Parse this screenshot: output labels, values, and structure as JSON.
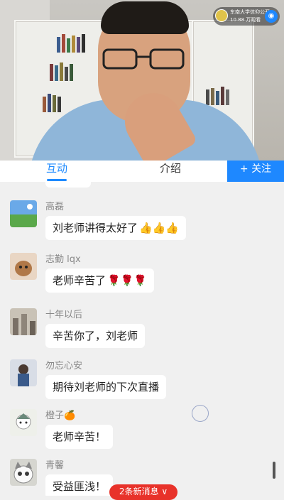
{
  "live": {
    "channel_name": "东南大学信仰公开",
    "views": "10.88 万观看"
  },
  "tabs": {
    "interact": "互动",
    "intro": "介绍",
    "follow": "+ 关注"
  },
  "messages": [
    {
      "user": "高磊",
      "text": "刘老师讲得太好了",
      "emoji": "👍👍👍"
    },
    {
      "user": "志勤 lqx",
      "text": "老师辛苦了",
      "emoji": "🌹🌹🌹"
    },
    {
      "user": "十年以后",
      "text": "辛苦你了，刘老师",
      "emoji": ""
    },
    {
      "user": "勿忘心安",
      "text": "期待刘老师的下次直播",
      "emoji": ""
    },
    {
      "user": "橙子🍊",
      "text": "老师辛苦！",
      "emoji": ""
    },
    {
      "user": "青馨",
      "text": "受益匪浅！",
      "emoji": ""
    }
  ],
  "new_messages": "2条新消息 ∨",
  "colors": {
    "accent": "#1e88ff",
    "new_msg_bg": "#e8322a"
  }
}
